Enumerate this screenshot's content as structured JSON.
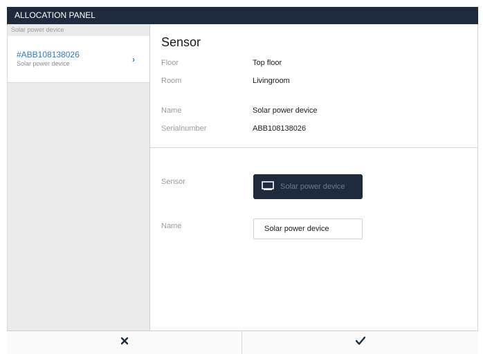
{
  "titlebar": {
    "title": "ALLOCATION PANEL"
  },
  "sidebar": {
    "header": "Solar power device",
    "items": [
      {
        "title": "#ABB108138026",
        "subtitle": "Solar power device",
        "chevron_icon": "chevron-right-icon"
      }
    ]
  },
  "details": {
    "section_title": "Sensor",
    "floor_label": "Floor",
    "floor_value": "Top floor",
    "room_label": "Room",
    "room_value": "Livingroom",
    "name_label": "Name",
    "name_value": "Solar power device",
    "serial_label": "Serialnumber",
    "serial_value": "ABB108138026"
  },
  "assignment": {
    "sensor_label": "Sensor",
    "sensor_button_label": "Solar power device",
    "sensor_button_icon": "monitor-icon",
    "name_label": "Name",
    "name_field_value": "Solar power device"
  },
  "footer": {
    "cancel_icon": "close-icon",
    "confirm_icon": "checkmark-icon"
  },
  "colors": {
    "titlebar": "#1f2b3c",
    "accent": "#2d7bbd",
    "sidebar_bg": "#ebebeb",
    "button_bg": "#1f2b3c"
  }
}
